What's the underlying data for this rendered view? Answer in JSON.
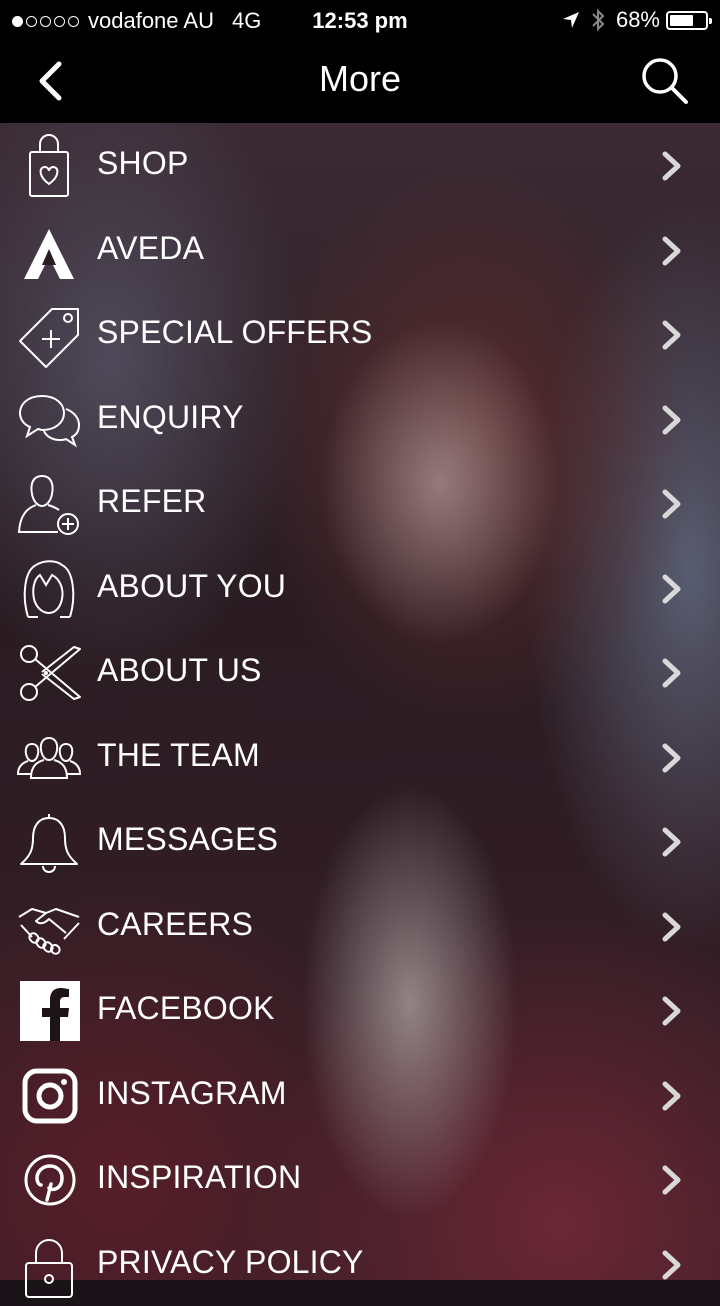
{
  "status_bar": {
    "signal_dots": 5,
    "signal_filled": 1,
    "carrier": "vodafone AU",
    "network": "4G",
    "time": "12:53 pm",
    "battery_percent": "68%",
    "battery_level": 0.68
  },
  "nav": {
    "title": "More",
    "back_icon": "chevron-left-icon",
    "search_icon": "search-icon"
  },
  "menu": {
    "items": [
      {
        "label": "SHOP",
        "icon": "shopping-bag-icon"
      },
      {
        "label": "AVEDA",
        "icon": "aveda-logo-icon"
      },
      {
        "label": "SPECIAL OFFERS",
        "icon": "price-tag-icon"
      },
      {
        "label": "ENQUIRY",
        "icon": "chat-bubbles-icon"
      },
      {
        "label": "REFER",
        "icon": "add-user-icon"
      },
      {
        "label": "ABOUT YOU",
        "icon": "woman-face-icon"
      },
      {
        "label": "ABOUT US",
        "icon": "scissors-icon"
      },
      {
        "label": "THE TEAM",
        "icon": "team-icon"
      },
      {
        "label": "MESSAGES",
        "icon": "bell-icon"
      },
      {
        "label": "CAREERS",
        "icon": "handshake-icon"
      },
      {
        "label": "FACEBOOK",
        "icon": "facebook-icon"
      },
      {
        "label": "INSTAGRAM",
        "icon": "instagram-icon"
      },
      {
        "label": "INSPIRATION",
        "icon": "pinterest-icon"
      },
      {
        "label": "PRIVACY POLICY",
        "icon": "lock-icon"
      }
    ],
    "chevron_color": "#d8d8d8"
  }
}
